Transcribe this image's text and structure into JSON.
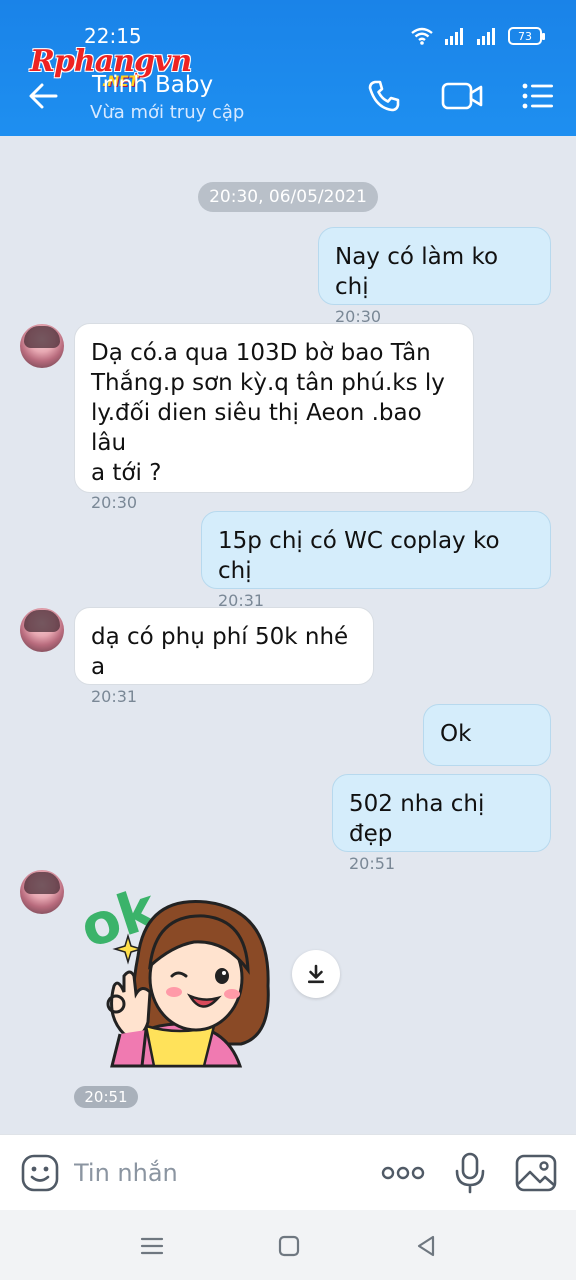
{
  "status_bar": {
    "time": "22:15",
    "battery": "73"
  },
  "watermark": {
    "main": "Rphangvn",
    "sub": ".NET"
  },
  "header": {
    "contact_name": "Trinh Baby",
    "contact_status": "Vừa mới truy cập",
    "icons": [
      "back-arrow-icon",
      "phone-icon",
      "video-camera-icon",
      "menu-list-icon"
    ]
  },
  "chat": {
    "date_separator": "20:30, 06/05/2021",
    "messages": [
      {
        "from": "me",
        "text": "Nay có làm ko chị",
        "time": "20:30"
      },
      {
        "from": "them",
        "line1": "Dạ có.a qua 103D bờ bao Tân",
        "line2": "Thắng.p sơn kỳ.q tân phú.ks ly",
        "line3": "ly.đối dien siêu thị Aeon .bao lâu",
        "line4": "a tới ?",
        "time": "20:30"
      },
      {
        "from": "me",
        "text": "15p chị có WC coplay ko chị",
        "time": "20:31"
      },
      {
        "from": "them",
        "text": "dạ có phụ phí 50k nhé a",
        "time": "20:31"
      },
      {
        "from": "me",
        "text": "Ok"
      },
      {
        "from": "me",
        "text": "502 nha chị đẹp",
        "time": "20:51"
      },
      {
        "from": "them",
        "type": "sticker",
        "sticker_text": "ok",
        "time": "20:51"
      }
    ]
  },
  "composer": {
    "placeholder": "Tin nhắn",
    "icons": [
      "emoji-icon",
      "more-dots-icon",
      "microphone-icon",
      "image-icon"
    ]
  },
  "colors": {
    "header": "#1e8ff0",
    "my_bubble": "#d5edfb",
    "their_bubble": "#ffffff",
    "chat_bg": "#e2e7ef",
    "sticker_ok": "#3bb36a"
  }
}
